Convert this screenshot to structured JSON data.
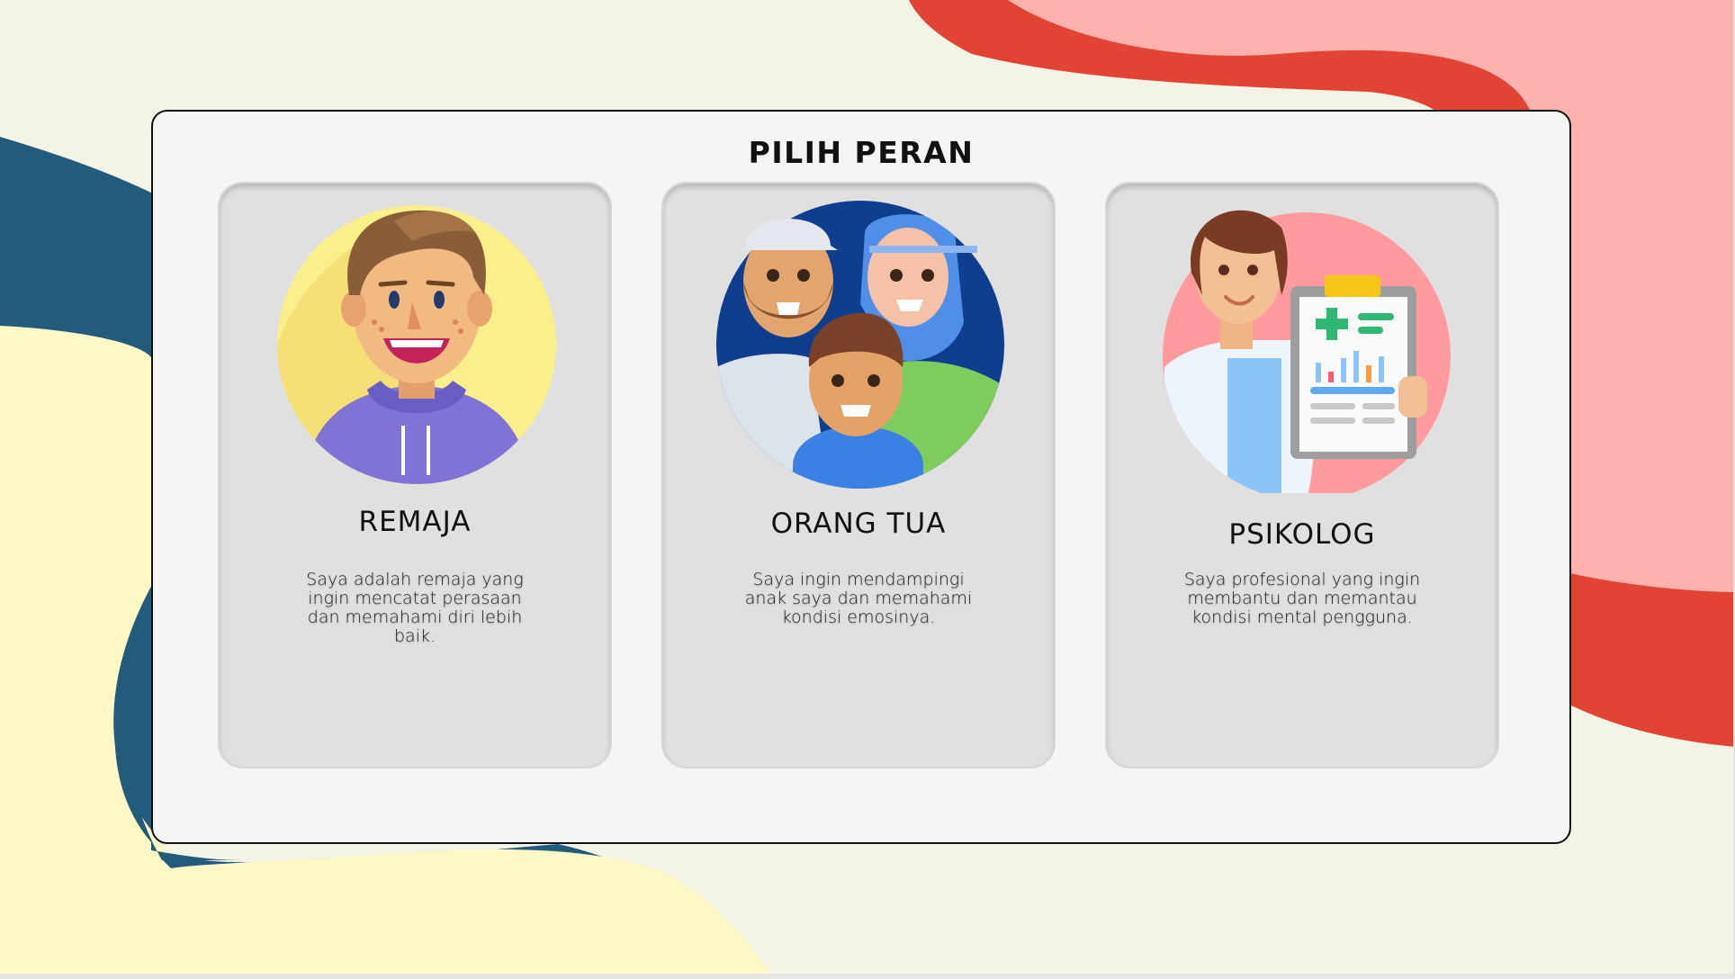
{
  "page_title": "PILIH PERAN",
  "roles": [
    {
      "name": "REMAJA",
      "description": "Saya adalah remaja yang ingin mencatat perasaan dan memahami diri lebih baik.",
      "icon": "teen-boy-avatar-icon"
    },
    {
      "name": "ORANG TUA",
      "description": "Saya ingin mendampingi anak saya dan memahami kondisi emosinya.",
      "icon": "family-avatar-icon"
    },
    {
      "name": "PSIKOLOG",
      "description": "Saya profesional yang ingin membantu dan memantau kondisi mental pengguna.",
      "icon": "psychologist-avatar-icon"
    }
  ],
  "colors": {
    "background": "#f4f4e6",
    "blob_blue": "#235b7c",
    "blob_yellow": "#fdf8c6",
    "blob_red": "#e14435",
    "blob_pink": "#ffb1ad",
    "panel": "#f5f5f5",
    "card": "#e0e0e0"
  }
}
